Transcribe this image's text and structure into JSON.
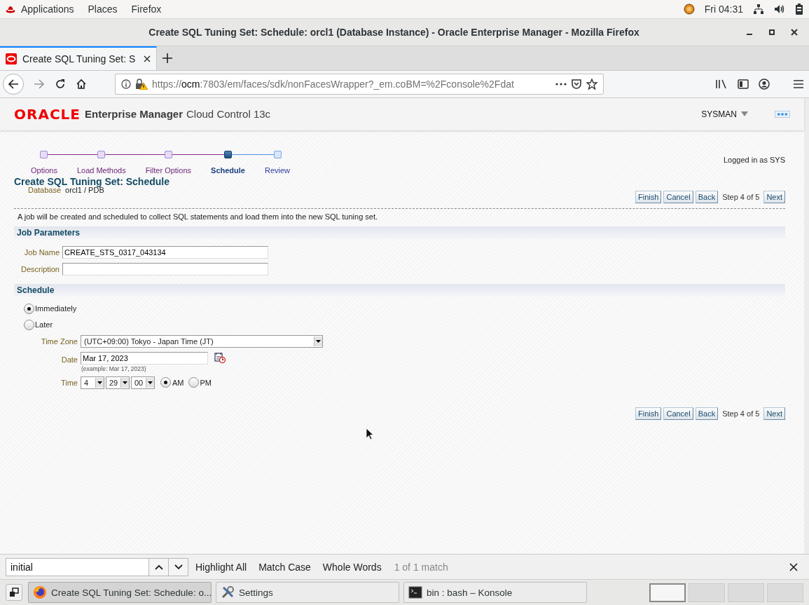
{
  "top_bar": {
    "menus": [
      "Applications",
      "Places",
      "Firefox"
    ],
    "clock": "Fri 04:31"
  },
  "window": {
    "title": "Create SQL Tuning Set: Schedule: orcl1 (Database Instance) - Oracle Enterprise Manager - Mozilla Firefox"
  },
  "tabs": [
    {
      "label": "Create SQL Tuning Set: S",
      "selected": true
    }
  ],
  "address_bar": {
    "url_host": "ocm",
    "url_before": "https://",
    "url_after": ":7803/em/faces/sdk/nonFacesWrapper?_em.coBM=%2Fconsole%2Fdat"
  },
  "em_header": {
    "logo": "ORACLE",
    "product": "Enterprise Manager",
    "edition": "Cloud Control 13c",
    "user": "SYSMAN"
  },
  "train": [
    {
      "label": "Options",
      "visited": true,
      "selected": false
    },
    {
      "label": "Load Methods",
      "visited": true,
      "selected": false
    },
    {
      "label": "Filter Options",
      "visited": true,
      "selected": false
    },
    {
      "label": "Schedule",
      "visited": false,
      "selected": true
    },
    {
      "label": "Review",
      "visited": false,
      "selected": false
    }
  ],
  "logged_in": "Logged in as SYS",
  "page_title": "Create SQL Tuning Set: Schedule",
  "database": {
    "label": "Database",
    "value": "orcl1 / PDB"
  },
  "nav_bars": [
    {
      "buttons": [
        "Finish",
        "Cancel",
        "Back"
      ],
      "step": "Step 4 of 5",
      "next": "Next"
    },
    {
      "buttons": [
        "Finish",
        "Cancel",
        "Back"
      ],
      "step": "Step 4 of 5",
      "next": "Next"
    }
  ],
  "intro": "A job will be created and scheduled to collect SQL statements and load them into the new SQL tuning set.",
  "job_parameters": {
    "heading": "Job Parameters",
    "fields": [
      {
        "label": "Job Name",
        "value": "CREATE_STS_0317_043134"
      },
      {
        "label": "Description"
      }
    ]
  },
  "schedule": {
    "heading": "Schedule",
    "options": [
      {
        "label": "Immediately",
        "selected": true
      },
      {
        "label": "Later",
        "selected": false
      }
    ],
    "time_zone": {
      "label": "Time Zone",
      "value": "(UTC+09:00) Tokyo - Japan Time (JT)"
    },
    "date": {
      "label": "Date",
      "value": "Mar 17, 2023",
      "hint": "(example: Mar 17, 2023)"
    },
    "time": {
      "label": "Time",
      "hour": "4",
      "minute": "29",
      "second": "00",
      "periods": [
        {
          "label": "AM",
          "selected": true
        },
        {
          "label": "PM",
          "selected": false
        }
      ]
    }
  },
  "find_bar": {
    "value": "initial",
    "options": [
      "Highlight All",
      "Match Case",
      "Whole Words"
    ],
    "status": "1 of 1 match"
  },
  "taskbar": {
    "items": [
      {
        "kind": "browser",
        "label": "Create SQL Tuning Set: Schedule: o...",
        "selected": true
      },
      {
        "kind": "settings",
        "label": "Settings",
        "selected": false
      },
      {
        "kind": "terminal",
        "label": "bin : bash – Konsole",
        "selected": false
      }
    ],
    "workspaces": [
      {
        "selected": true
      },
      {
        "selected": false
      },
      {
        "selected": false
      },
      {
        "selected": false
      }
    ]
  }
}
